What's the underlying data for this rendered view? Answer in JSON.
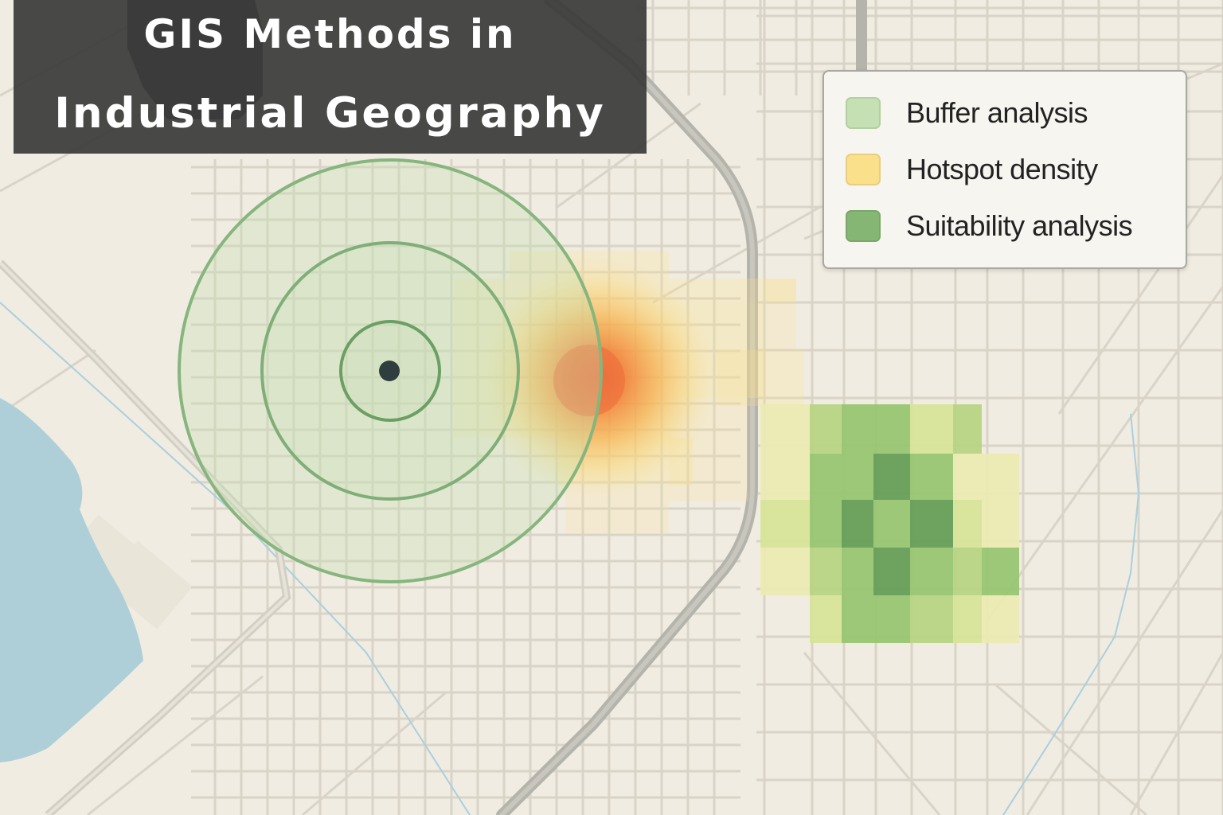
{
  "title": {
    "line1": "GIS Methods in",
    "line2": "Industrial Geography"
  },
  "legend": {
    "items": [
      {
        "label": "Buffer analysis",
        "color": "#c5e0b2"
      },
      {
        "label": "Hotspot density",
        "color": "#fbe08c"
      },
      {
        "label": "Suitability analysis",
        "color": "#86b673"
      }
    ]
  },
  "colors": {
    "background": "#f0ece1",
    "street": "#d9d4c7",
    "highway": "#b4b4ac",
    "water": "#aecfd8",
    "buffer_stroke": "#86b57d",
    "hotspot_core": "#ef6a3a"
  }
}
